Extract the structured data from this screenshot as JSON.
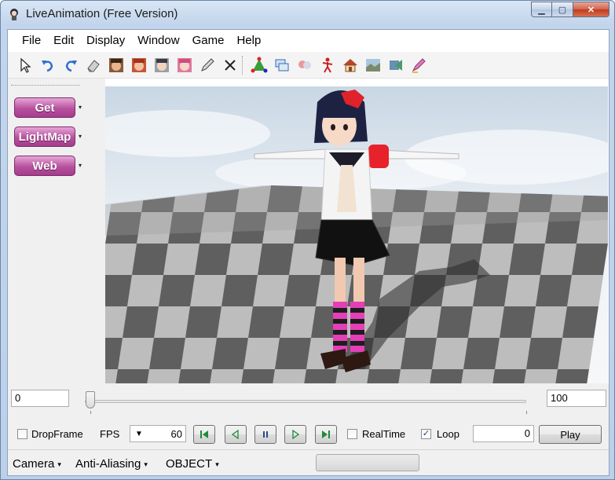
{
  "window": {
    "title": "LiveAnimation (Free Version)",
    "min_glyph": "▁",
    "max_glyph": "▢",
    "close_glyph": "✕"
  },
  "menu": [
    "File",
    "Edit",
    "Display",
    "Window",
    "Game",
    "Help"
  ],
  "toolbar": [
    "select-arrow-icon",
    "undo-icon",
    "redo-icon",
    "eraser-icon",
    "character-face-1-icon",
    "character-face-2-icon",
    "character-face-3-icon",
    "character-face-4-icon",
    "pen-icon",
    "delete-x-icon",
    "triangle-mesh-icon",
    "windows-icon",
    "character-group-icon",
    "pose-figure-icon",
    "house-icon",
    "landscape-icon",
    "export-icon",
    "marker-icon"
  ],
  "left_panel": {
    "buttons": [
      {
        "label": "Get",
        "arrow": "▾"
      },
      {
        "label": "LightMap",
        "arrow": "▾"
      },
      {
        "label": "Web",
        "arrow": "▾"
      }
    ]
  },
  "timeline": {
    "start": "0",
    "end": "100",
    "position_fraction": 0.0
  },
  "controls": {
    "dropframe_label": "DropFrame",
    "dropframe_checked": false,
    "fps_label": "FPS",
    "fps_value": "60",
    "fps_arrow": "▼",
    "realtime_label": "RealTime",
    "realtime_checked": false,
    "loop_label": "Loop",
    "loop_checked": true,
    "loop_check_glyph": "✓",
    "frame_value": "0",
    "play_label": "Play"
  },
  "statusbar": {
    "camera_label": "Camera",
    "aa_label": "Anti-Aliasing",
    "object_label": "OBJECT",
    "arrow": "▾"
  },
  "colors": {
    "accent_pink": "#b7519e",
    "floor_dark": "#5f5f5f",
    "floor_light": "#bdbdbd"
  }
}
